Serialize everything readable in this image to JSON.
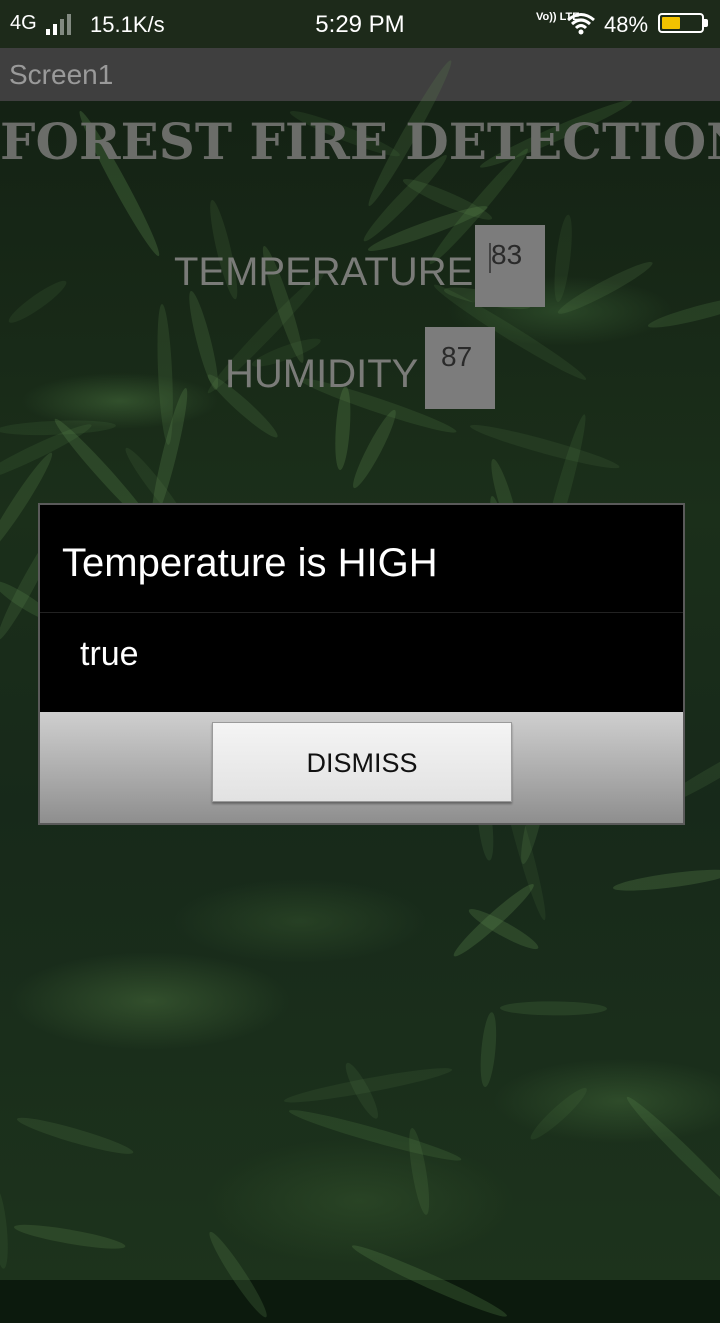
{
  "status_bar": {
    "network": "4G",
    "speed": "15.1K/s",
    "time": "5:29 PM",
    "volte": "Vo)) LTE",
    "battery_percent": "48%",
    "battery_level": 0.48,
    "battery_color": "#f2c200"
  },
  "app": {
    "screen_title": "Screen1",
    "heading": "FOREST FIRE DETECTION"
  },
  "readings": {
    "temperature_label": "TEMPERATURE",
    "temperature_value": "83",
    "humidity_label": "HUMIDITY",
    "humidity_value": "87"
  },
  "dialog": {
    "title": "Temperature is HIGH",
    "message": "true",
    "dismiss_label": "DISMISS"
  }
}
